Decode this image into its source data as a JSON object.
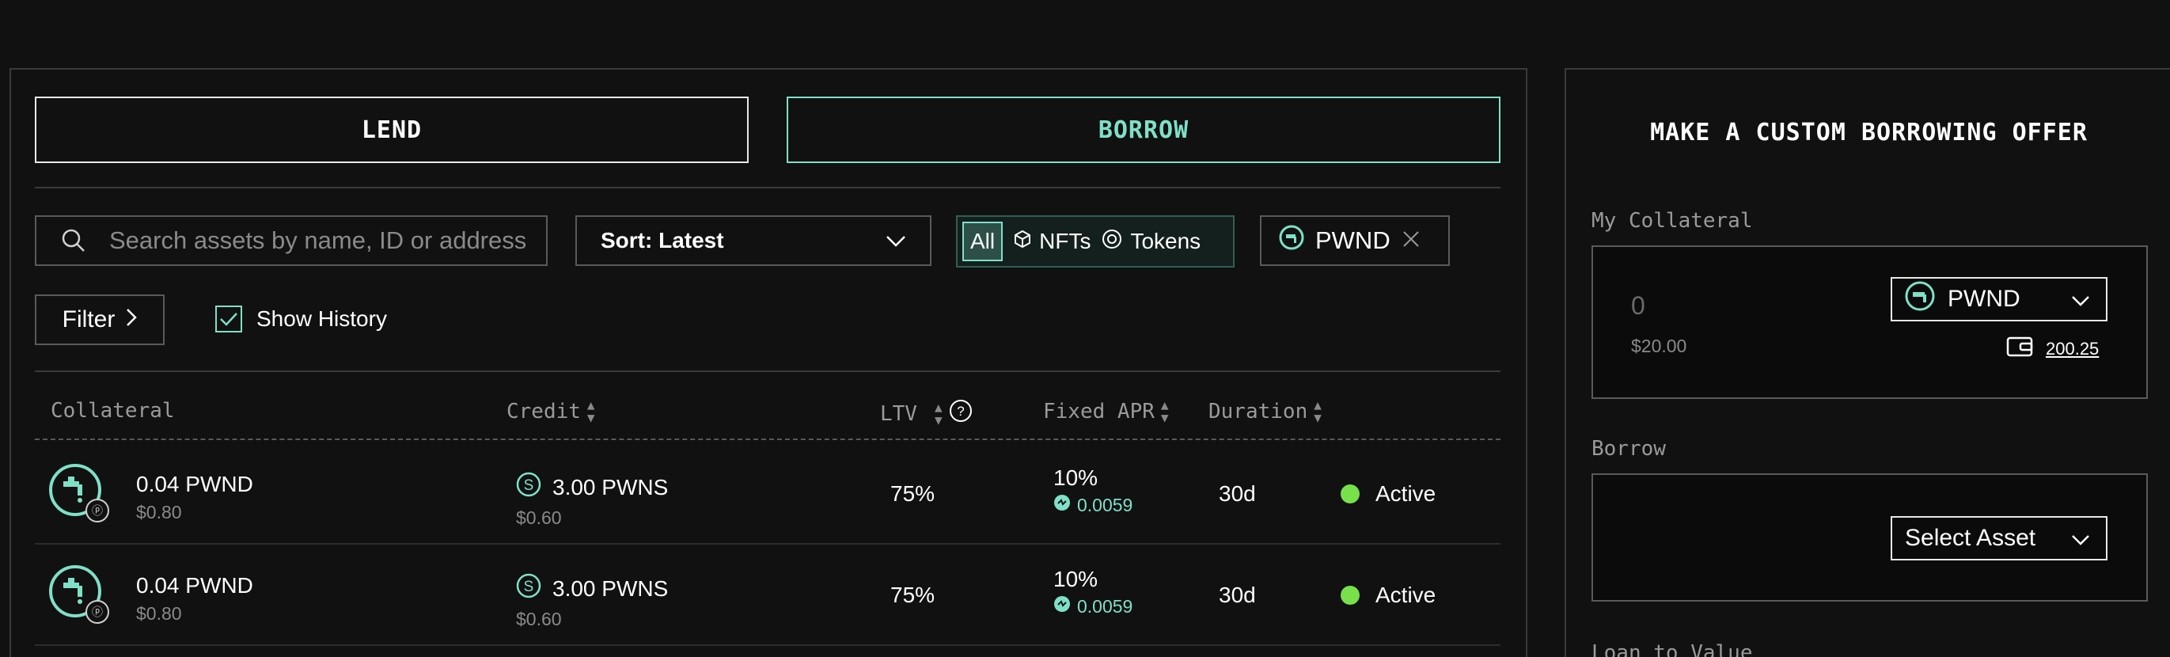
{
  "mode_tabs": {
    "lend": "LEND",
    "borrow": "BORROW"
  },
  "search": {
    "placeholder": "Search assets by name, ID or address"
  },
  "sort": {
    "label": "Sort: Latest"
  },
  "asset_type": {
    "all": "All",
    "nfts": "NFTs",
    "tokens": "Tokens"
  },
  "active_filter_chip": {
    "label": "PWND"
  },
  "filter": {
    "label": "Filter"
  },
  "show_history": {
    "label": "Show History",
    "checked": true
  },
  "table": {
    "headers": {
      "collateral": "Collateral",
      "credit": "Credit",
      "ltv": "LTV",
      "apr": "Fixed APR",
      "duration": "Duration"
    },
    "rows": [
      {
        "collateral_amount": "0.04 PWND",
        "collateral_usd": "$0.80",
        "credit_amount": "3.00 PWNS",
        "credit_usd": "$0.60",
        "ltv": "75%",
        "apr": "10%",
        "apr_reward": "0.0059",
        "duration": "30d",
        "status": "Active"
      },
      {
        "collateral_amount": "0.04 PWND",
        "collateral_usd": "$0.80",
        "credit_amount": "3.00 PWNS",
        "credit_usd": "$0.60",
        "ltv": "75%",
        "apr": "10%",
        "apr_reward": "0.0059",
        "duration": "30d",
        "status": "Active"
      }
    ]
  },
  "custom_offer": {
    "title": "MAKE A CUSTOM BORROWING OFFER",
    "collateral_label": "My Collateral",
    "collateral_amount": "0",
    "collateral_usd": "$20.00",
    "collateral_asset": "PWND",
    "wallet_balance": "200.25",
    "borrow_label": "Borrow",
    "borrow_select": "Select Asset",
    "ltv_label": "Loan to Value"
  },
  "colors": {
    "accent": "#7fe0c8",
    "status_active": "#77e04a",
    "background": "#111111",
    "border": "#3a3a3a"
  }
}
